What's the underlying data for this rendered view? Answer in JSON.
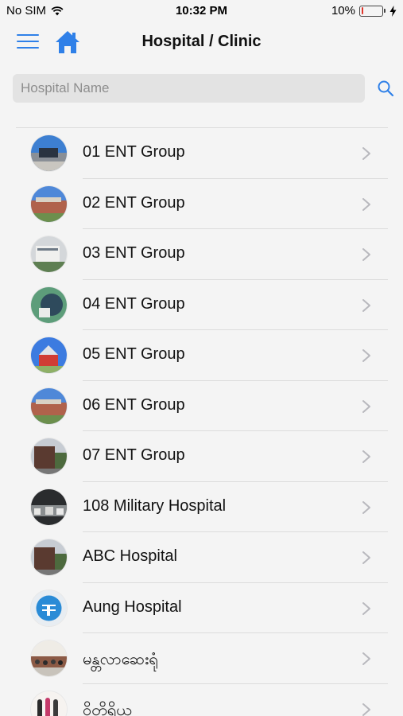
{
  "status_bar": {
    "carrier": "No SIM",
    "time": "10:32 PM",
    "battery_percent": "10%",
    "battery_level": 0.1
  },
  "nav": {
    "title": "Hospital / Clinic",
    "menu_icon": "hamburger-menu-icon",
    "home_icon": "home-icon"
  },
  "search": {
    "placeholder": "Hospital Name",
    "value": "",
    "icon": "search-icon"
  },
  "colors": {
    "accent": "#2f80e8",
    "battery_low": "#e0352b"
  },
  "hospitals": [
    {
      "name": "01 ENT Group",
      "thumb": "sky"
    },
    {
      "name": "02 ENT Group",
      "thumb": "brick"
    },
    {
      "name": "03 ENT Group",
      "thumb": "grey"
    },
    {
      "name": "04 ENT Group",
      "thumb": "green"
    },
    {
      "name": "05 ENT Group",
      "thumb": "red"
    },
    {
      "name": "06 ENT Group",
      "thumb": "brick"
    },
    {
      "name": "07 ENT Group",
      "thumb": "dark"
    },
    {
      "name": "108 Military Hospital",
      "thumb": "night"
    },
    {
      "name": "ABC Hospital",
      "thumb": "dark"
    },
    {
      "name": "Aung Hospital",
      "thumb": "logo"
    },
    {
      "name": "မန္တလာဆေးရုံ",
      "thumb": "crowd"
    },
    {
      "name": "ဝိတိုရိယ",
      "thumb": "bottles"
    }
  ]
}
